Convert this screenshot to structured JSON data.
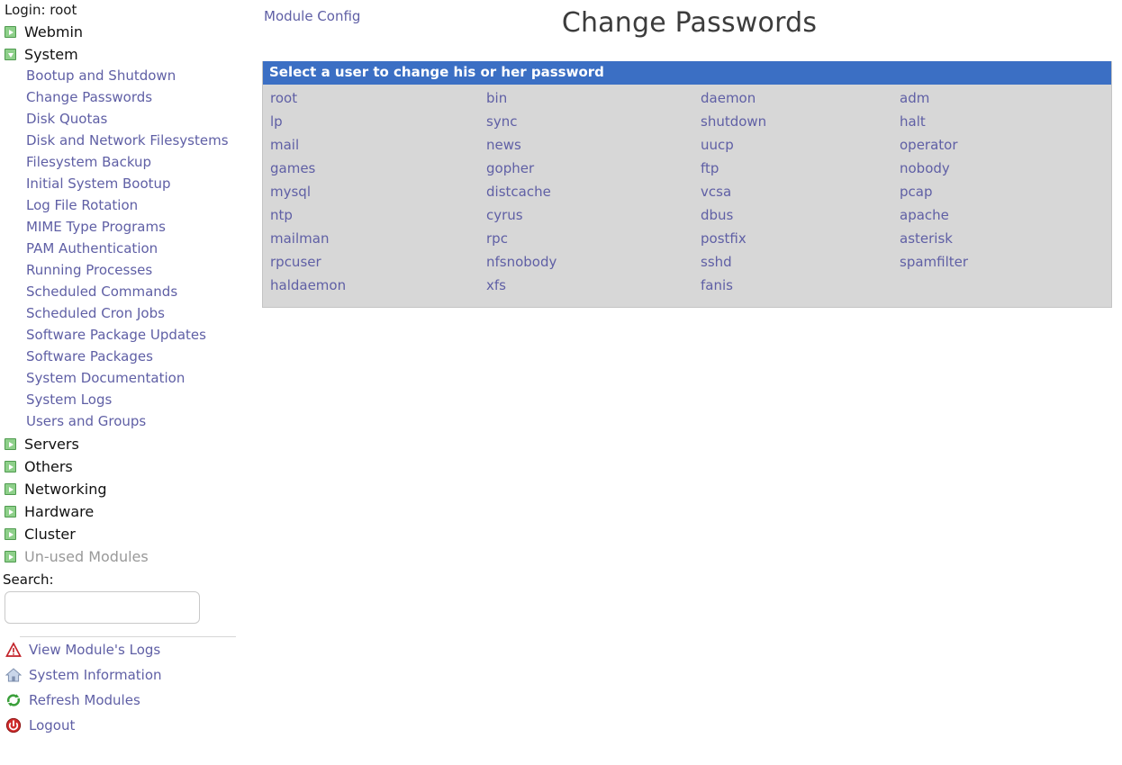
{
  "sidebar": {
    "login_text": "Login: root",
    "categories": [
      {
        "label": "Webmin",
        "state": "collapsed",
        "icon": "expand-right-icon",
        "muted": false
      },
      {
        "label": "System",
        "state": "expanded",
        "icon": "expand-down-icon",
        "muted": false
      }
    ],
    "system_modules": [
      "Bootup and Shutdown",
      "Change Passwords",
      "Disk Quotas",
      "Disk and Network Filesystems",
      "Filesystem Backup",
      "Initial System Bootup",
      "Log File Rotation",
      "MIME Type Programs",
      "PAM Authentication",
      "Running Processes",
      "Scheduled Commands",
      "Scheduled Cron Jobs",
      "Software Package Updates",
      "Software Packages",
      "System Documentation",
      "System Logs",
      "Users and Groups"
    ],
    "more_categories": [
      {
        "label": "Servers",
        "state": "collapsed",
        "icon": "expand-right-icon",
        "muted": false
      },
      {
        "label": "Others",
        "state": "collapsed",
        "icon": "expand-right-icon",
        "muted": false
      },
      {
        "label": "Networking",
        "state": "collapsed",
        "icon": "expand-right-icon",
        "muted": false
      },
      {
        "label": "Hardware",
        "state": "collapsed",
        "icon": "expand-right-icon",
        "muted": false
      },
      {
        "label": "Cluster",
        "state": "collapsed",
        "icon": "expand-right-icon",
        "muted": false
      },
      {
        "label": "Un-used Modules",
        "state": "collapsed",
        "icon": "expand-right-icon",
        "muted": true
      }
    ],
    "search": {
      "label": "Search:",
      "value": "",
      "placeholder": ""
    },
    "footer_links": [
      {
        "label": "View Module's Logs",
        "icon": "warning-triangle-icon"
      },
      {
        "label": "System Information",
        "icon": "home-icon"
      },
      {
        "label": "Refresh Modules",
        "icon": "refresh-icon"
      },
      {
        "label": "Logout",
        "icon": "power-icon"
      }
    ]
  },
  "main": {
    "module_config_label": "Module Config",
    "title": "Change Passwords",
    "table": {
      "header": "Select a user to change his or her password",
      "columns": 4,
      "rows": [
        [
          "root",
          "bin",
          "daemon",
          "adm"
        ],
        [
          "lp",
          "sync",
          "shutdown",
          "halt"
        ],
        [
          "mail",
          "news",
          "uucp",
          "operator"
        ],
        [
          "games",
          "gopher",
          "ftp",
          "nobody"
        ],
        [
          "mysql",
          "distcache",
          "vcsa",
          "pcap"
        ],
        [
          "ntp",
          "cyrus",
          "dbus",
          "apache"
        ],
        [
          "mailman",
          "rpc",
          "postfix",
          "asterisk"
        ],
        [
          "rpcuser",
          "nfsnobody",
          "sshd",
          "spamfilter"
        ],
        [
          "haldaemon",
          "xfs",
          "fanis",
          ""
        ]
      ]
    }
  },
  "colors": {
    "link": "#5f5fa5",
    "header_bar": "#3b6fc4",
    "table_bg": "#d7d7d7",
    "category_icon": "#8ed08a",
    "title_text": "#3c3c3c",
    "muted_text": "#999999"
  }
}
